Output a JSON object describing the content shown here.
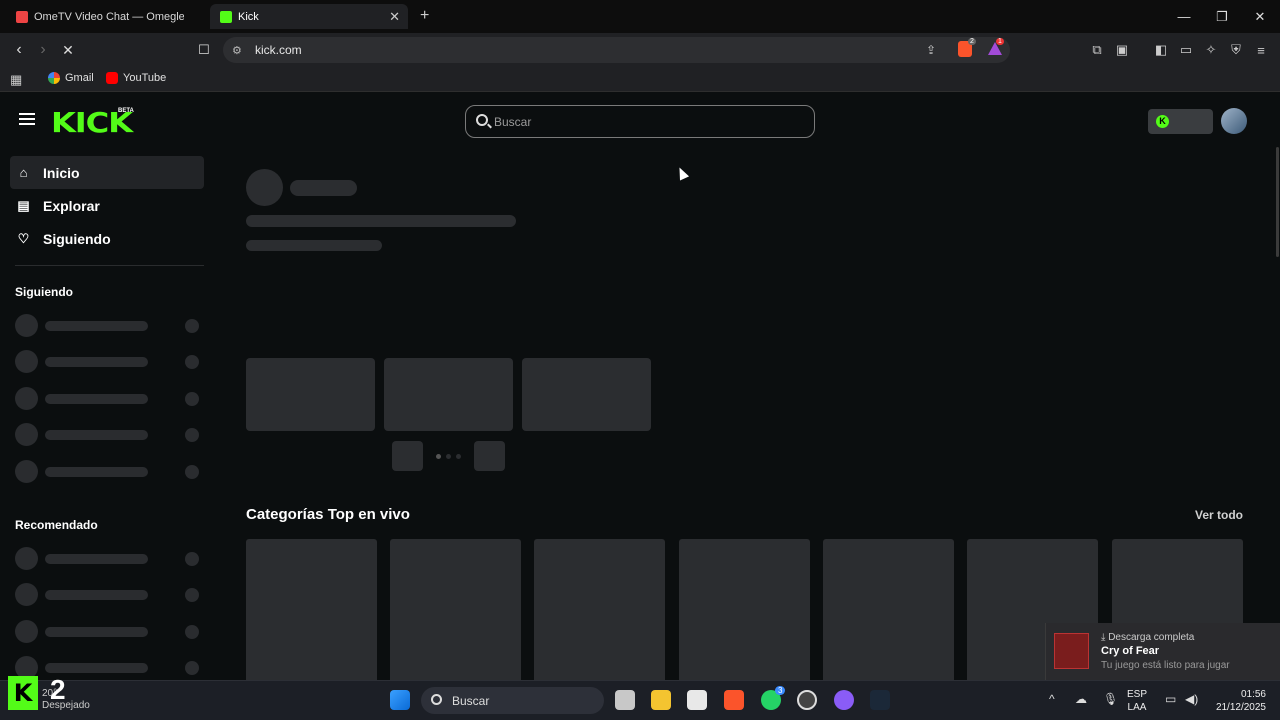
{
  "browser": {
    "tabs": [
      {
        "title": "OmeTV Video Chat — Omegle R",
        "active": false
      },
      {
        "title": "Kick",
        "active": true
      }
    ],
    "new_tab": "+",
    "url": "kick.com",
    "bookmarks": [
      {
        "label": "Gmail"
      },
      {
        "label": "YouTube"
      }
    ],
    "badges": {
      "brave_shields": "2",
      "rewards": "1"
    }
  },
  "site": {
    "logo": "KICK",
    "beta": "BETA",
    "search_placeholder": "Buscar",
    "nav": [
      {
        "label": "Inicio",
        "icon": "home-icon",
        "active": true
      },
      {
        "label": "Explorar",
        "icon": "explore-icon",
        "active": false
      },
      {
        "label": "Siguiendo",
        "icon": "heart-icon",
        "active": false
      }
    ],
    "following_header": "Siguiendo",
    "recommended_header": "Recomendado",
    "top_categories_title": "Categorías Top en vivo",
    "see_all": "Ver todo"
  },
  "notification": {
    "header": "Descarga completa",
    "title": "Cry of Fear",
    "body": "Tu juego está listo para jugar"
  },
  "taskbar": {
    "search_placeholder": "Buscar",
    "widget_number": "2",
    "weather_temp": "20°",
    "weather_text": "Despejado",
    "lang_top": "ESP",
    "lang_bottom": "LAA",
    "time": "01:56",
    "date": "21/12/2025",
    "whatsapp_badge": "3"
  },
  "colors": {
    "kick_green": "#53fc18",
    "background": "#0b0e0f",
    "skeleton": "#2b2d30"
  }
}
